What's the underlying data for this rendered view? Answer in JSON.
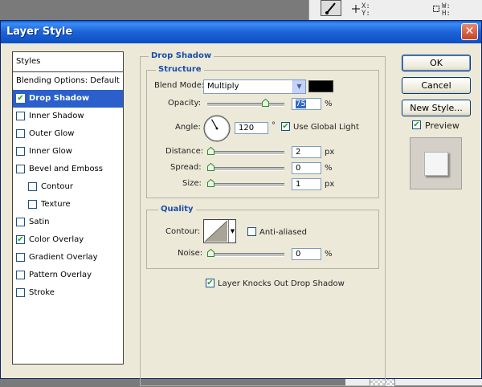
{
  "background": {
    "readout_xy": "X:\nY:",
    "readout_wh": "W:\nH:"
  },
  "dialog": {
    "title": "Layer Style",
    "close_glyph": "✕"
  },
  "styles": {
    "header": "Styles",
    "items": [
      {
        "label": "Blending Options: Default",
        "checkbox": false,
        "checked": false,
        "indent": false,
        "selected": false
      },
      {
        "label": "Drop Shadow",
        "checkbox": true,
        "checked": true,
        "indent": false,
        "selected": true
      },
      {
        "label": "Inner Shadow",
        "checkbox": true,
        "checked": false,
        "indent": false,
        "selected": false
      },
      {
        "label": "Outer Glow",
        "checkbox": true,
        "checked": false,
        "indent": false,
        "selected": false
      },
      {
        "label": "Inner Glow",
        "checkbox": true,
        "checked": false,
        "indent": false,
        "selected": false
      },
      {
        "label": "Bevel and Emboss",
        "checkbox": true,
        "checked": false,
        "indent": false,
        "selected": false
      },
      {
        "label": "Contour",
        "checkbox": true,
        "checked": false,
        "indent": true,
        "selected": false
      },
      {
        "label": "Texture",
        "checkbox": true,
        "checked": false,
        "indent": true,
        "selected": false
      },
      {
        "label": "Satin",
        "checkbox": true,
        "checked": false,
        "indent": false,
        "selected": false
      },
      {
        "label": "Color Overlay",
        "checkbox": true,
        "checked": true,
        "indent": false,
        "selected": false
      },
      {
        "label": "Gradient Overlay",
        "checkbox": true,
        "checked": false,
        "indent": false,
        "selected": false
      },
      {
        "label": "Pattern Overlay",
        "checkbox": true,
        "checked": false,
        "indent": false,
        "selected": false
      },
      {
        "label": "Stroke",
        "checkbox": true,
        "checked": false,
        "indent": false,
        "selected": false
      }
    ]
  },
  "drop_shadow": {
    "title": "Drop Shadow",
    "structure_title": "Structure",
    "blend_mode_label": "Blend Mode:",
    "blend_mode_value": "Multiply",
    "shadow_color": "#000000",
    "opacity_label": "Opacity:",
    "opacity_value": "75",
    "opacity_fraction": 0.75,
    "opacity_unit": "%",
    "angle_label": "Angle:",
    "angle_value": "120",
    "angle_unit": "°",
    "use_global_light_label": "Use Global Light",
    "use_global_light_checked": true,
    "distance_label": "Distance:",
    "distance_value": "2",
    "distance_unit": "px",
    "spread_label": "Spread:",
    "spread_value": "0",
    "spread_unit": "%",
    "size_label": "Size:",
    "size_value": "1",
    "size_unit": "px",
    "quality_title": "Quality",
    "contour_label": "Contour:",
    "anti_aliased_label": "Anti-aliased",
    "anti_aliased_checked": false,
    "noise_label": "Noise:",
    "noise_value": "0",
    "noise_unit": "%",
    "knockout_label": "Layer Knocks Out Drop Shadow",
    "knockout_checked": true
  },
  "buttons": {
    "ok": "OK",
    "cancel": "Cancel",
    "new_style": "New Style...",
    "preview_label": "Preview",
    "preview_checked": true
  }
}
